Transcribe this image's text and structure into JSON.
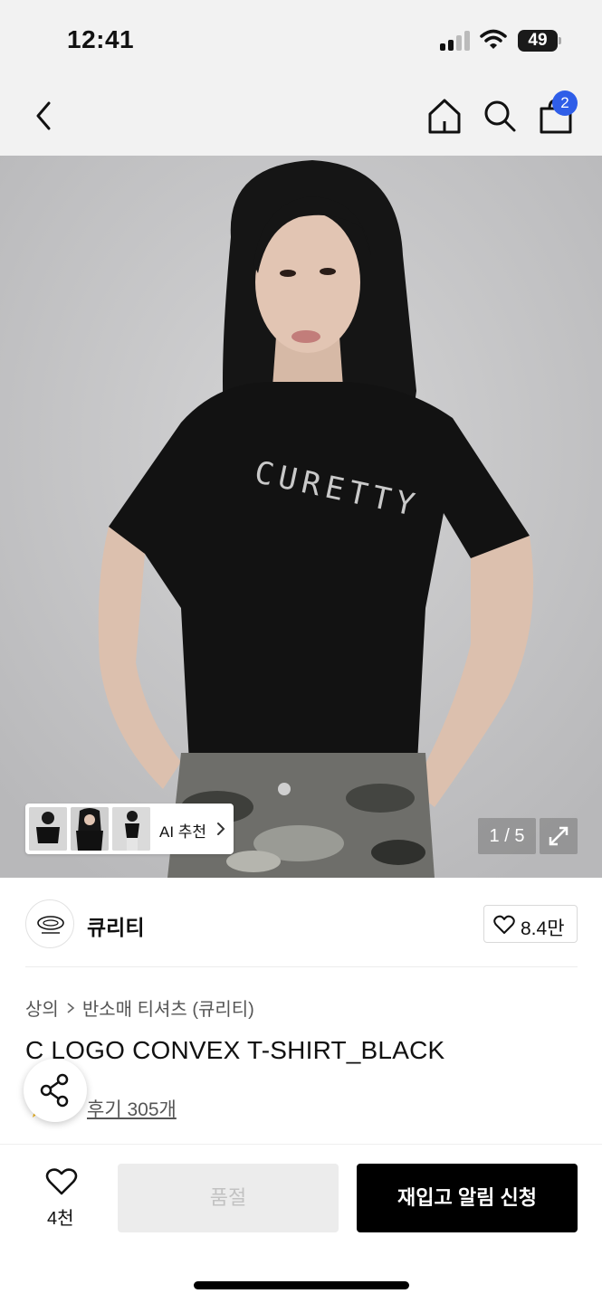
{
  "status_bar": {
    "time": "12:41",
    "battery": "49",
    "icons": [
      "signal-icon",
      "wifi-icon",
      "battery-icon"
    ]
  },
  "nav": {
    "icons": [
      "back-icon",
      "home-icon",
      "search-icon",
      "cart-icon"
    ],
    "cart_badge": "2"
  },
  "hero": {
    "print_text": "CURETTY",
    "ai_label": "AI 추천",
    "counter": "1 / 5",
    "icons": [
      "chevron-right-icon",
      "expand-icon"
    ]
  },
  "brand": {
    "name": "큐리티",
    "likes": "8.4만",
    "icons": [
      "heart-icon"
    ]
  },
  "product": {
    "breadcrumb": [
      "상의",
      "반소매 티셔츠 (큐리티)"
    ],
    "title": "C LOGO CONVEX T-SHIRT_BLACK",
    "review": "후기 305개",
    "icons": [
      "star-icon",
      "share-icon"
    ]
  },
  "bottom": {
    "wish_count": "4천",
    "soldout_label": "품절",
    "restock_label": "재입고 알림 신청",
    "icons": [
      "heart-icon"
    ]
  },
  "colors": {
    "header_bg": "#f2f2f2",
    "accent_blue": "#2f5ee8",
    "primary_button": "#000000",
    "disabled_button": "#ececec"
  }
}
